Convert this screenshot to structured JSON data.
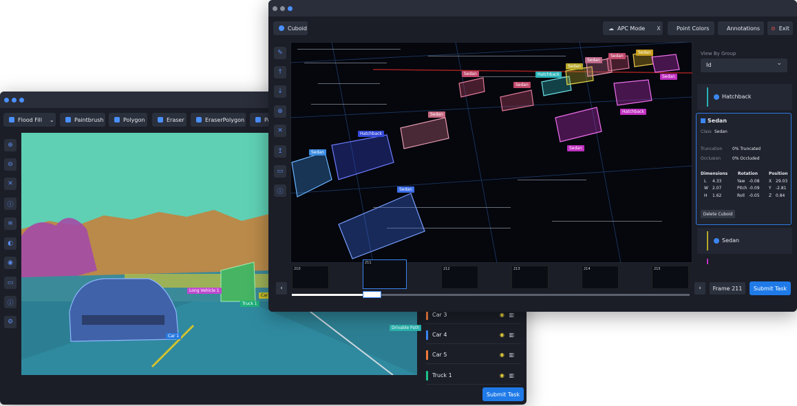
{
  "back_window": {
    "toolbar": [
      {
        "label": "Flood Fill",
        "icon": "bucket-icon"
      },
      {
        "label": "Paintbrush",
        "icon": "brush-icon"
      },
      {
        "label": "Polygon",
        "icon": "polygon-icon"
      },
      {
        "label": "Eraser",
        "icon": "eraser-icon"
      },
      {
        "label": "EraserPolygon",
        "icon": "eraser-polygon-icon"
      },
      {
        "label": "Pai",
        "icon": "paint-icon"
      }
    ],
    "labels": {
      "car1": "Car 1",
      "truck1": "Truck 1",
      "left_label": "Long Vehicle 1",
      "right_label": "Drivable Path",
      "car_small": "Car"
    },
    "list": [
      {
        "label": "Car 3",
        "color": "#f07a3b"
      },
      {
        "label": "Car 4",
        "color": "#3b86f0"
      },
      {
        "label": "Car 5",
        "color": "#f07a3b"
      },
      {
        "label": "Truck 1",
        "color": "#1fc28a"
      }
    ],
    "submit": "Submit Task"
  },
  "front_window": {
    "cuboid_btn": "Cuboid",
    "apc_mode": "APC Mode",
    "close_x": "X",
    "point_colors": "Point Colors",
    "annotations": "Annotations",
    "exit": "Exit",
    "view_by_group_label": "View By Group",
    "view_by_group_value": "Id",
    "groups": {
      "hatchback": "Hatchback",
      "sedan": "Sedan",
      "sedan2": "Sedan"
    },
    "detail": {
      "title": "Sedan",
      "class_label": "Class",
      "class_value": "Sedan",
      "truncation_label": "Truncation",
      "truncation_value": "0% Truncated",
      "occlusion_label": "Occlusion",
      "occlusion_value": "0% Occluded",
      "dimensions_title": "Dimensions",
      "rotation_title": "Rotation",
      "position_title": "Position",
      "dims": [
        [
          "L",
          "4.33"
        ],
        [
          "W",
          "2.07"
        ],
        [
          "H",
          "1.62"
        ]
      ],
      "rot": [
        [
          "Yaw",
          "-0.08"
        ],
        [
          "Pitch",
          "-0.09"
        ],
        [
          "Roll",
          "-0.05"
        ]
      ],
      "pos": [
        [
          "X",
          "29.03"
        ],
        [
          "Y",
          "-2.81"
        ],
        [
          "Z",
          "0.84"
        ]
      ],
      "delete": "Delete Cuboid"
    },
    "cuboid_labels": [
      {
        "text": "Sedan",
        "color": "#3b8be0"
      },
      {
        "text": "Hatchback",
        "color": "#3448d8"
      },
      {
        "text": "Sedan",
        "color": "#3b6ee8"
      },
      {
        "text": "Sedan",
        "color": "#c66a82"
      },
      {
        "text": "Sedan",
        "color": "#c0486a"
      },
      {
        "text": "Sedan",
        "color": "#c0486a"
      },
      {
        "text": "Hatchback",
        "color": "#2ab3b8"
      },
      {
        "text": "Sedan",
        "color": "#b8a828"
      },
      {
        "text": "Sedan",
        "color": "#c06a8a"
      },
      {
        "text": "Sedan",
        "color": "#c0486a"
      },
      {
        "text": "Sedan",
        "color": "#c8a020"
      },
      {
        "text": "Sedan",
        "color": "#c030c0"
      },
      {
        "text": "Hatchback",
        "color": "#c030c0"
      },
      {
        "text": "Sedan",
        "color": "#c030c0"
      }
    ],
    "frames": [
      "210",
      "211",
      "212",
      "213",
      "214",
      "215"
    ],
    "frame_label": "Frame 211",
    "submit": "Submit Task"
  }
}
